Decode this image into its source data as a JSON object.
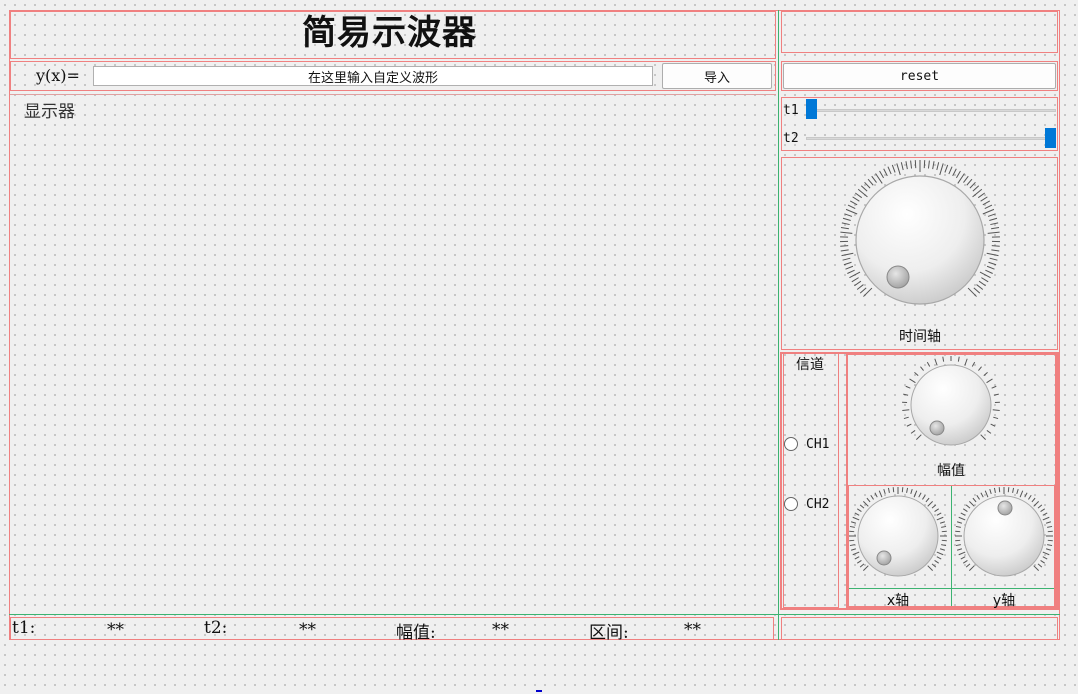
{
  "title": "简易示波器",
  "input_row": {
    "label": "y(x)=",
    "placeholder": "在这里输入自定义波形",
    "import_button": "导入"
  },
  "reset_button": "reset",
  "display_label": "显示器",
  "sliders": {
    "t1_label": "t1",
    "t2_label": "t2",
    "t1_value": 0.0,
    "t2_value": 1.0
  },
  "knobs": {
    "time_axis_label": "时间轴",
    "amplitude_label": "幅值",
    "x_axis_label": "x轴",
    "y_axis_label": "y轴"
  },
  "channels": {
    "title": "信道",
    "ch1": "CH1",
    "ch2": "CH2"
  },
  "status_bar": {
    "t1_label": "t1:",
    "t1_value": "**",
    "t2_label": "t2:",
    "t2_value": "**",
    "amp_label": "幅值:",
    "amp_value": "**",
    "range_label": "区间:",
    "range_value": "**"
  },
  "colors": {
    "frame_red": "#f08080",
    "slider_handle": "#0078d7"
  }
}
